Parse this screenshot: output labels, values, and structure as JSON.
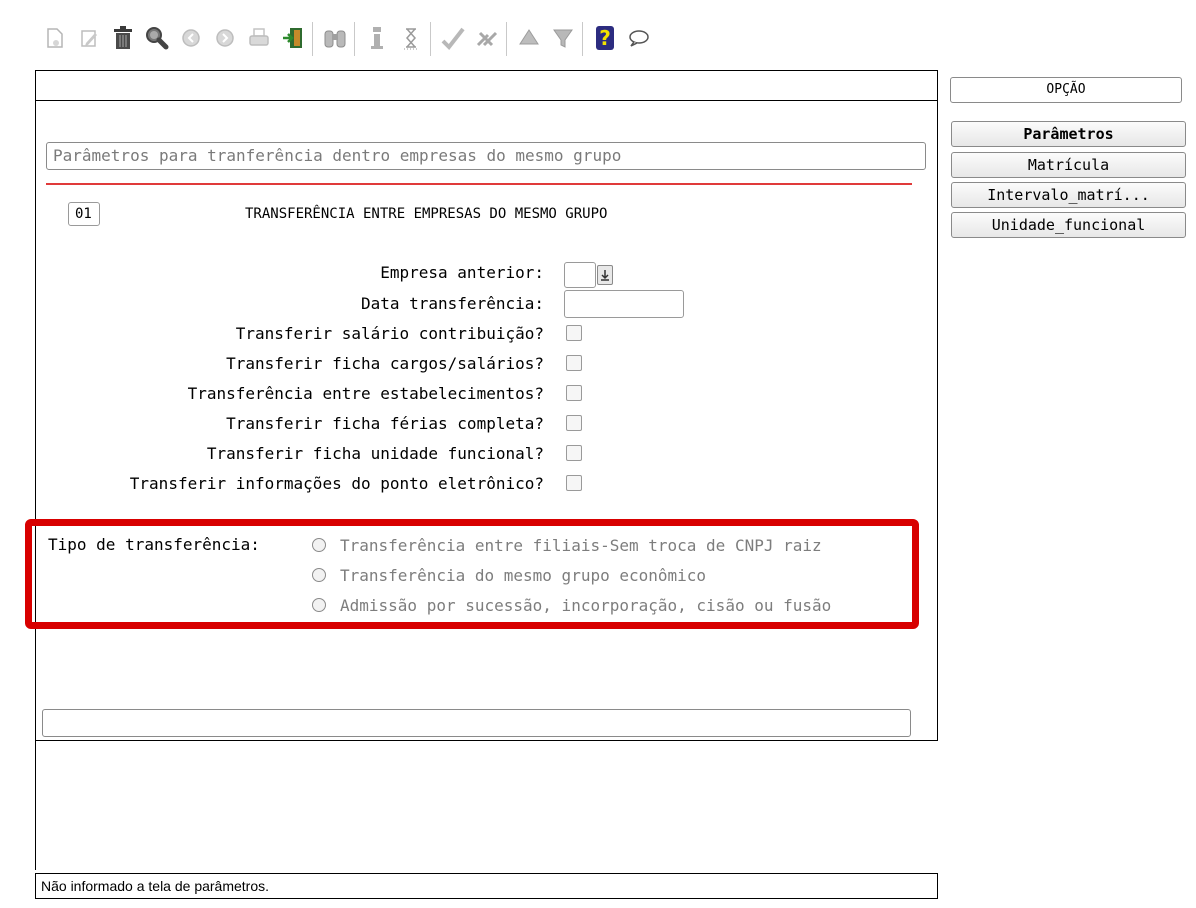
{
  "toolbar": {
    "icons": [
      "new-document-icon",
      "edit-icon",
      "delete-trash-icon",
      "search-icon",
      "previous-icon",
      "next-icon",
      "print-icon",
      "exit-icon",
      "binoculars-icon",
      "info-icon",
      "hourglass-icon",
      "confirm-check-icon",
      "cancel-tools-icon",
      "up-arrow-icon",
      "filter-icon",
      "help-icon",
      "chat-icon"
    ]
  },
  "form": {
    "title": "Parâmetros para tranferência dentro empresas do mesmo grupo",
    "section_number": "01",
    "section_title": "TRANSFERÊNCIA ENTRE EMPRESAS DO MESMO GRUPO",
    "fields": [
      {
        "label": "Empresa anterior:"
      },
      {
        "label": "Data transferência:"
      },
      {
        "label": "Transferir salário contribuição?"
      },
      {
        "label": "Transferir ficha cargos/salários?"
      },
      {
        "label": "Transferência entre estabelecimentos?"
      },
      {
        "label": "Transferir ficha férias completa?"
      },
      {
        "label": "Transferir ficha unidade funcional?"
      },
      {
        "label": "Transferir informações do ponto eletrônico?"
      }
    ],
    "tipo_transferencia": {
      "label": "Tipo de transferência:",
      "options": [
        "Transferência entre filiais-Sem troca de CNPJ raiz",
        "Transferência do mesmo grupo econômico",
        "Admissão por sucessão, incorporação, cisão ou fusão"
      ],
      "highlight_color": "#d80000"
    }
  },
  "status": {
    "message": "Não informado a tela de parâmetros."
  },
  "side_panel": {
    "opcao_label": "OPÇÃO",
    "buttons": [
      "Parâmetros",
      "Matrícula",
      "Intervalo_matrí...",
      "Unidade_funcional"
    ]
  }
}
